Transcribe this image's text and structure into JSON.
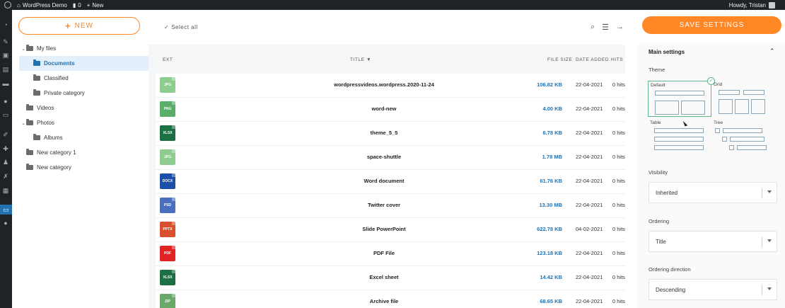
{
  "adminbar": {
    "site_name": "WordPress Demo",
    "comments_count": "0",
    "new_label": "New",
    "howdy": "Howdy, Tristan"
  },
  "toolbar": {
    "new_button": "NEW",
    "select_all": "Select all",
    "save_settings": "SAVE SETTINGS"
  },
  "tree": [
    {
      "label": "My files",
      "level": 0,
      "expanded": true,
      "selected": false
    },
    {
      "label": "Documents",
      "level": 1,
      "expanded": false,
      "selected": true
    },
    {
      "label": "Classified",
      "level": 1,
      "expanded": false,
      "selected": false
    },
    {
      "label": "Private category",
      "level": 1,
      "expanded": false,
      "selected": false
    },
    {
      "label": "Videos",
      "level": 0,
      "expanded": false,
      "selected": false
    },
    {
      "label": "Photos",
      "level": 0,
      "expanded": true,
      "selected": false
    },
    {
      "label": "Albums",
      "level": 1,
      "expanded": false,
      "selected": false
    },
    {
      "label": "New category 1",
      "level": 0,
      "expanded": false,
      "selected": false
    },
    {
      "label": "New category",
      "level": 0,
      "expanded": false,
      "selected": false
    }
  ],
  "table": {
    "columns": {
      "ext": "EXT",
      "title": "TITLE ▼",
      "size": "FILE SIZE",
      "date": "DATE ADDED",
      "hits": "HITS"
    },
    "rows": [
      {
        "title": "wordpressvideos.wordpress.2020-11-24",
        "size": "106.82 KB",
        "date": "22-04-2021",
        "hits": "0 hits",
        "ext": "JPG",
        "color": "#8fcc8f"
      },
      {
        "title": "word-new",
        "size": "4.00 KB",
        "date": "22-04-2021",
        "hits": "0 hits",
        "ext": "PNG",
        "color": "#5bad6a"
      },
      {
        "title": "theme_5_5",
        "size": "6.78 KB",
        "date": "22-04-2021",
        "hits": "0 hits",
        "ext": "XLSX",
        "color": "#1d7044"
      },
      {
        "title": "space-shuttle",
        "size": "1.78 MB",
        "date": "22-04-2021",
        "hits": "0 hits",
        "ext": "JPG",
        "color": "#8fcc8f"
      },
      {
        "title": "Word document",
        "size": "61.76 KB",
        "date": "22-04-2021",
        "hits": "0 hits",
        "ext": "DOCX",
        "color": "#1b4fa8"
      },
      {
        "title": "Twitter cover",
        "size": "13.30 MB",
        "date": "22-04-2021",
        "hits": "0 hits",
        "ext": "PSD",
        "color": "#4a6fc0"
      },
      {
        "title": "Slide PowerPoint",
        "size": "622.78 KB",
        "date": "04-02-2021",
        "hits": "0 hits",
        "ext": "PPTX",
        "color": "#d9502e"
      },
      {
        "title": "PDF File",
        "size": "123.18 KB",
        "date": "22-04-2021",
        "hits": "0 hits",
        "ext": "PDF",
        "color": "#e02424"
      },
      {
        "title": "Excel sheet",
        "size": "14.42 KB",
        "date": "22-04-2021",
        "hits": "0 hits",
        "ext": "XLSX",
        "color": "#1d7044"
      },
      {
        "title": "Archive file",
        "size": "68.65 KB",
        "date": "22-04-2021",
        "hits": "0 hits",
        "ext": "ZIP",
        "color": "#6aa86a"
      }
    ]
  },
  "settings": {
    "section_title": "Main settings",
    "theme_label": "Theme",
    "themes": {
      "default": "Default",
      "grid": "Grid",
      "table": "Table",
      "tree": "Tree"
    },
    "visibility_label": "Visibility",
    "visibility_value": "Inherited",
    "ordering_label": "Ordering",
    "ordering_value": "Title",
    "direction_label": "Ordering direction",
    "direction_value": "Descending"
  },
  "colors": {
    "accent": "#ff8726",
    "link": "#2271b1",
    "selected_theme": "#5cb88a"
  }
}
